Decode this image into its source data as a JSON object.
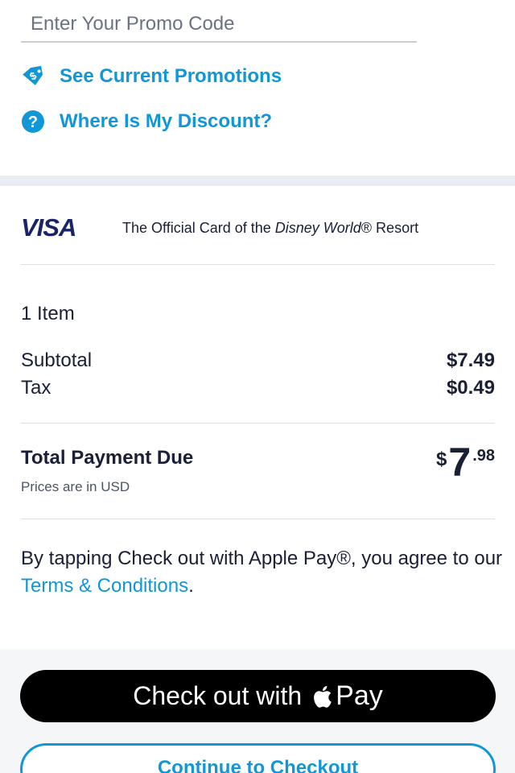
{
  "promo": {
    "placeholder": "Enter Your Promo Code",
    "value": ""
  },
  "links": {
    "promotions": {
      "label": "See Current Promotions",
      "icon": "price-tag-icon"
    },
    "discount": {
      "label": "Where Is My Discount?",
      "icon": "question-circle-icon"
    }
  },
  "visa": {
    "logo": "VISA",
    "text_before": "The Official Card of the ",
    "text_italic": "Disney World",
    "text_after": "® Resort"
  },
  "summary": {
    "item_count": "1 Item",
    "subtotal_label": "Subtotal",
    "subtotal_value": "$7.49",
    "tax_label": "Tax",
    "tax_value": "$0.49",
    "total_label": "Total Payment Due",
    "total_note": "Prices are in USD",
    "total_currency": "$",
    "total_dollars": "7",
    "total_cents": ".98"
  },
  "terms": {
    "prefix": "By tapping Check out with Apple Pay®, you agree to our ",
    "link": "Terms & Conditions",
    "suffix": "."
  },
  "buttons": {
    "apple_pay_prefix": "Check out with",
    "apple_pay_word": "Pay",
    "continue": "Continue to Checkout"
  },
  "colors": {
    "accent": "#1197d6",
    "text": "#1a1f36",
    "visa_blue": "#1a2466",
    "band": "#e9edf3"
  }
}
